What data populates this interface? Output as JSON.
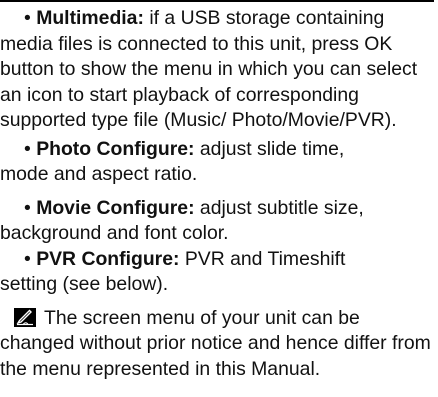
{
  "bullets": [
    {
      "marker": "•",
      "term": "Multimedia",
      "separator": ":",
      "first_line": " if a USB storage containing",
      "rest": "media files is connected to this unit, press OK button to show the menu in which you can select an icon to start playback of corresponding supported type file (Music/ Photo/Movie/PVR)."
    },
    {
      "marker": "•",
      "term": "Photo Configure:",
      "first_line": " adjust slide time,",
      "rest": "mode and aspect ratio."
    },
    {
      "marker": "•",
      "term": "Movie Configure:",
      "first_line": " adjust subtitle size,",
      "rest": "background and font color."
    },
    {
      "marker": "•",
      "term": "PVR Configure:",
      "first_line": " PVR and Timeshift",
      "rest": "setting (see below)."
    }
  ],
  "note": {
    "icon": "note-pencil-icon",
    "first_line": "The screen menu of your unit can be",
    "rest": "changed without prior notice and hence differ from the menu represented in this Manual."
  }
}
